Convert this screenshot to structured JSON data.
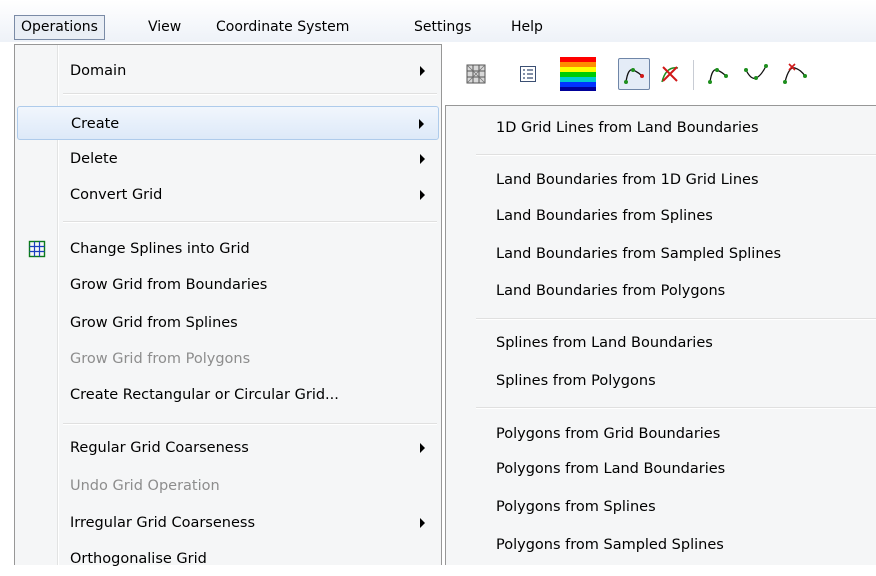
{
  "menubar": {
    "items": [
      {
        "label": "Operations",
        "active": true
      },
      {
        "label": "View"
      },
      {
        "label": "Coordinate System"
      },
      {
        "label": "Settings"
      },
      {
        "label": "Help"
      }
    ]
  },
  "toolbar": {
    "tools": [
      {
        "icon": "grid-pattern-icon"
      },
      {
        "icon": "list-icon"
      },
      {
        "icon": "color-spectrum-icon"
      },
      {
        "icon": "draw-spline-icon",
        "pressed": true
      },
      {
        "icon": "delete-spline-icon"
      },
      {
        "icon": "spline-insert-icon"
      },
      {
        "icon": "spline-move-icon"
      },
      {
        "icon": "spline-delete-point-icon"
      }
    ]
  },
  "operations_menu": {
    "items": [
      {
        "label": "Domain",
        "submenu": true
      },
      {
        "label": "Create",
        "submenu": true,
        "highlighted": true
      },
      {
        "label": "Delete",
        "submenu": true
      },
      {
        "label": "Convert Grid",
        "submenu": true
      },
      {
        "label": "Change Splines into Grid",
        "icon": "grid-icon"
      },
      {
        "label": "Grow Grid from Boundaries"
      },
      {
        "label": "Grow Grid from Splines"
      },
      {
        "label": "Grow Grid from Polygons",
        "disabled": true
      },
      {
        "label": "Create Rectangular or Circular Grid..."
      },
      {
        "label": "Regular Grid Coarseness",
        "submenu": true
      },
      {
        "label": "Undo Grid Operation",
        "disabled": true
      },
      {
        "label": "Irregular Grid Coarseness",
        "submenu": true
      },
      {
        "label": "Orthogonalise Grid"
      }
    ]
  },
  "create_submenu": {
    "items": [
      {
        "label": "1D Grid Lines from Land Boundaries"
      },
      {
        "label": "Land Boundaries from 1D Grid Lines"
      },
      {
        "label": "Land Boundaries from Splines"
      },
      {
        "label": "Land Boundaries from Sampled Splines"
      },
      {
        "label": "Land Boundaries from Polygons"
      },
      {
        "label": "Splines from Land Boundaries"
      },
      {
        "label": "Splines from Polygons"
      },
      {
        "label": "Polygons from Grid Boundaries"
      },
      {
        "label": "Polygons from Land Boundaries"
      },
      {
        "label": "Polygons from Splines"
      },
      {
        "label": "Polygons from Sampled Splines"
      }
    ]
  }
}
